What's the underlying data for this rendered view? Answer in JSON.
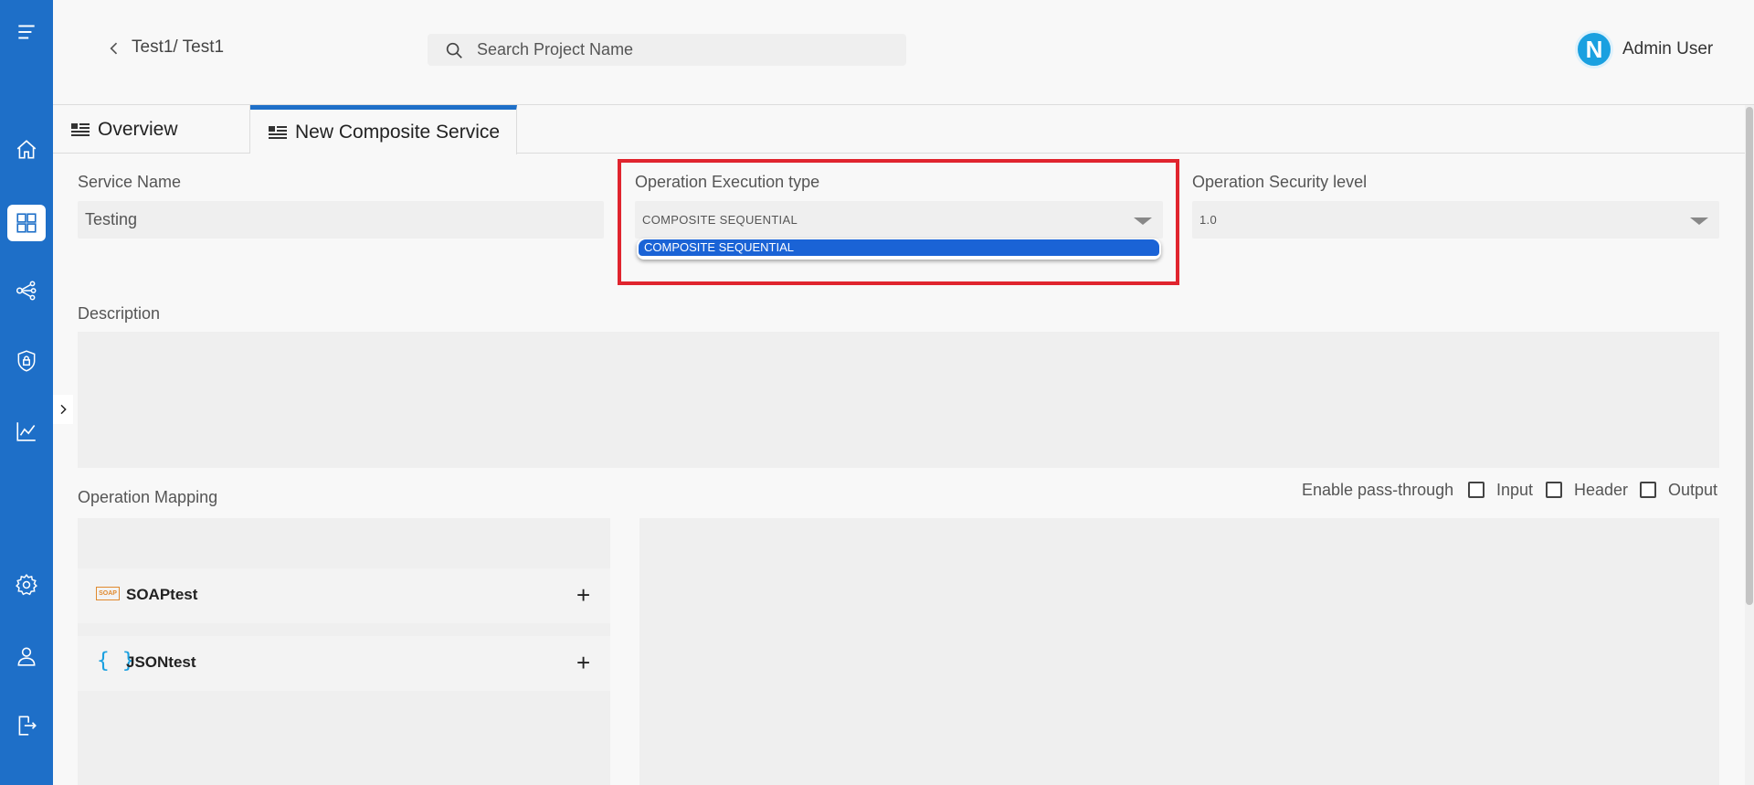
{
  "rail": {
    "items": [
      {
        "name": "menu-icon"
      },
      {
        "name": "home-icon"
      },
      {
        "name": "dashboard-icon",
        "active": true
      },
      {
        "name": "share-nodes-icon"
      },
      {
        "name": "shield-lock-icon"
      },
      {
        "name": "chart-line-icon"
      },
      {
        "name": "gear-icon"
      },
      {
        "name": "user-icon"
      },
      {
        "name": "logout-icon"
      }
    ],
    "accent": "#1e6fc8"
  },
  "header": {
    "breadcrumb": "Test1/ Test1",
    "search_placeholder": "Search Project Name",
    "avatar_letter": "N",
    "user_name": "Admin User"
  },
  "tabs": [
    {
      "label": "Overview"
    },
    {
      "label": "New Composite Service",
      "active": true
    }
  ],
  "form": {
    "service_name_label": "Service Name",
    "service_name_value": "Testing",
    "exec_type_label": "Operation Execution type",
    "exec_type_value": "COMPOSITE SEQUENTIAL",
    "exec_type_options": [
      "COMPOSITE SEQUENTIAL"
    ],
    "security_label": "Operation Security level",
    "security_value": "1.0",
    "description_label": "Description",
    "description_value": ""
  },
  "mapping": {
    "label": "Operation Mapping",
    "pass_through_label": "Enable pass-through",
    "checkboxes": [
      {
        "label": "Input",
        "checked": false
      },
      {
        "label": "Header",
        "checked": false
      },
      {
        "label": "Output",
        "checked": false
      }
    ],
    "services": [
      {
        "name": "SOAPtest",
        "badge": "SOAP",
        "type": "soap"
      },
      {
        "name": "JSONtest",
        "badge": "{ }",
        "type": "json"
      }
    ],
    "add_symbol": "+"
  },
  "colors": {
    "highlight_box": "#e0242e",
    "selected_option": "#1a63d6"
  }
}
